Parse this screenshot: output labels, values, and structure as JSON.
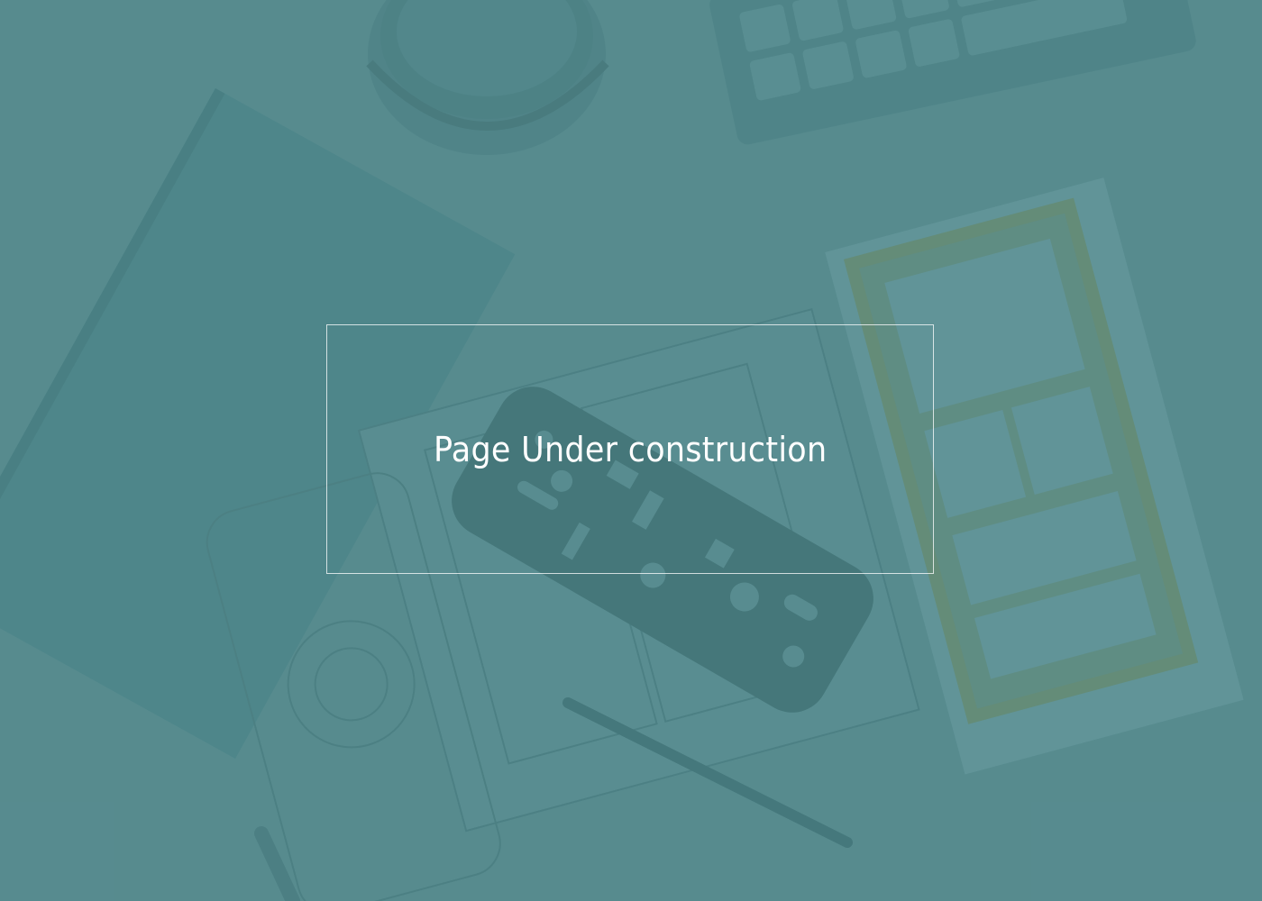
{
  "page": {
    "message": "Page Under construction"
  },
  "theme": {
    "background": "#5a8b8f",
    "text_color": "#ffffff",
    "border_color": "#ffffff"
  },
  "background_image": {
    "icon": "desk-workspace-photo"
  }
}
